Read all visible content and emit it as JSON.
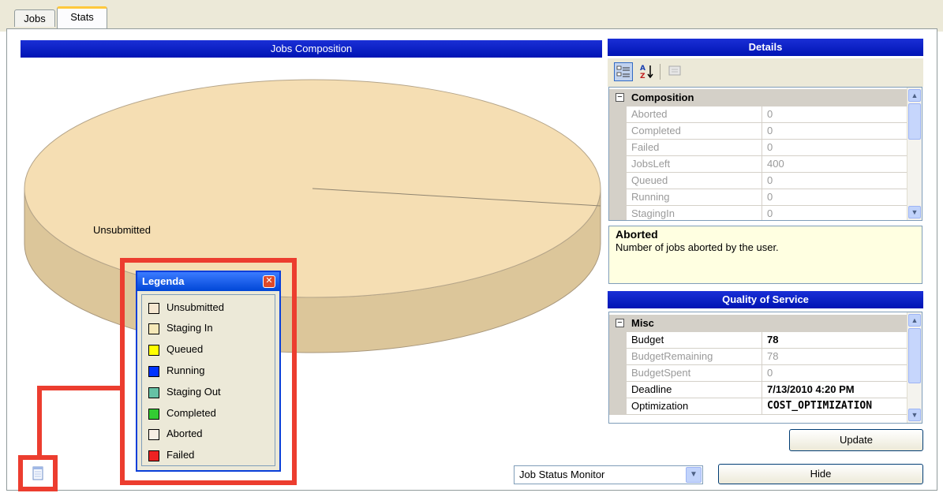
{
  "tabs": [
    {
      "label": "Jobs",
      "active": false
    },
    {
      "label": "Stats",
      "active": true
    }
  ],
  "composition_panel": {
    "title": "Jobs Composition"
  },
  "chart_data": {
    "type": "pie",
    "title": "Jobs Composition",
    "categories": [
      "Unsubmitted"
    ],
    "values": [
      400
    ],
    "slice_labels": [
      "Unsubmitted"
    ],
    "colors": {
      "Unsubmitted": "#f5deb3"
    }
  },
  "legend": {
    "title": "Legenda",
    "items": [
      {
        "label": "Unsubmitted",
        "color": "#f5e6d0"
      },
      {
        "label": "Staging In",
        "color": "#f5e8b8"
      },
      {
        "label": "Queued",
        "color": "#ffff00"
      },
      {
        "label": "Running",
        "color": "#0033ff"
      },
      {
        "label": "Staging Out",
        "color": "#66c2a5"
      },
      {
        "label": "Completed",
        "color": "#33cc33"
      },
      {
        "label": "Aborted",
        "color": "#f8efe5"
      },
      {
        "label": "Failed",
        "color": "#ee2222"
      }
    ]
  },
  "details": {
    "title": "Details",
    "category": "Composition",
    "rows": [
      {
        "name": "Aborted",
        "value": "0"
      },
      {
        "name": "Completed",
        "value": "0"
      },
      {
        "name": "Failed",
        "value": "0"
      },
      {
        "name": "JobsLeft",
        "value": "400"
      },
      {
        "name": "Queued",
        "value": "0"
      },
      {
        "name": "Running",
        "value": "0"
      },
      {
        "name": "StagingIn",
        "value": "0"
      }
    ],
    "description_title": "Aborted",
    "description_text": "Number of jobs aborted by the user."
  },
  "qos": {
    "title": "Quality of Service",
    "category": "Misc",
    "rows": [
      {
        "name": "Budget",
        "value": "78",
        "style": "bold"
      },
      {
        "name": "BudgetRemaining",
        "value": "78",
        "style": "dim"
      },
      {
        "name": "BudgetSpent",
        "value": "0",
        "style": "dim"
      },
      {
        "name": "Deadline",
        "value": "7/13/2010 4:20 PM",
        "style": "bold"
      },
      {
        "name": "Optimization",
        "value": "COST_OPTIMIZATION",
        "style": "mono"
      }
    ]
  },
  "buttons": {
    "update": "Update",
    "hide": "Hide"
  },
  "monitor_select": {
    "value": "Job Status Monitor"
  },
  "colors": {
    "header_blue": "#0014b4",
    "highlight_red": "#ec3d2f",
    "pie_top": "#f5deb3",
    "pie_side": "#dcc69a"
  }
}
